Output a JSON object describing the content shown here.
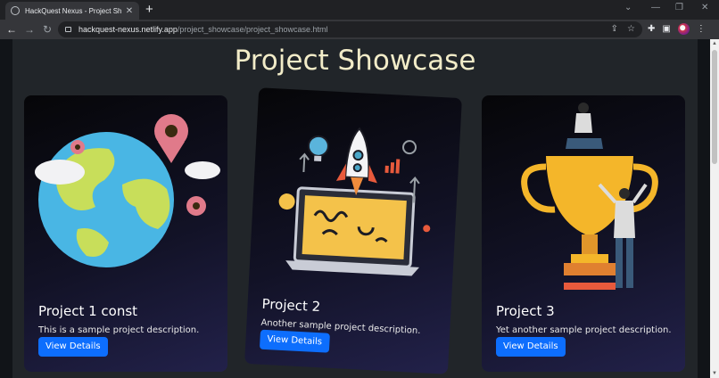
{
  "browser": {
    "tab_title": "HackQuest Nexus - Project Showc",
    "url_host": "hackquest-nexus.netlify.app",
    "url_path": "/project_showcase/project_showcase.html"
  },
  "page": {
    "title": "Project Showcase"
  },
  "cards": [
    {
      "title": "Project 1 const",
      "description": "This is a sample project description.",
      "button": "View Details",
      "image": "globe-with-map-pins"
    },
    {
      "title": "Project 2",
      "description": "Another sample project description.",
      "button": "View Details",
      "image": "rocket-laptop-startup"
    },
    {
      "title": "Project 3",
      "description": "Yet another sample project description.",
      "button": "View Details",
      "image": "trophy-with-people"
    }
  ],
  "colors": {
    "title": "#f2ecc8",
    "button": "#0d6efd",
    "page_bg": "#212529"
  }
}
